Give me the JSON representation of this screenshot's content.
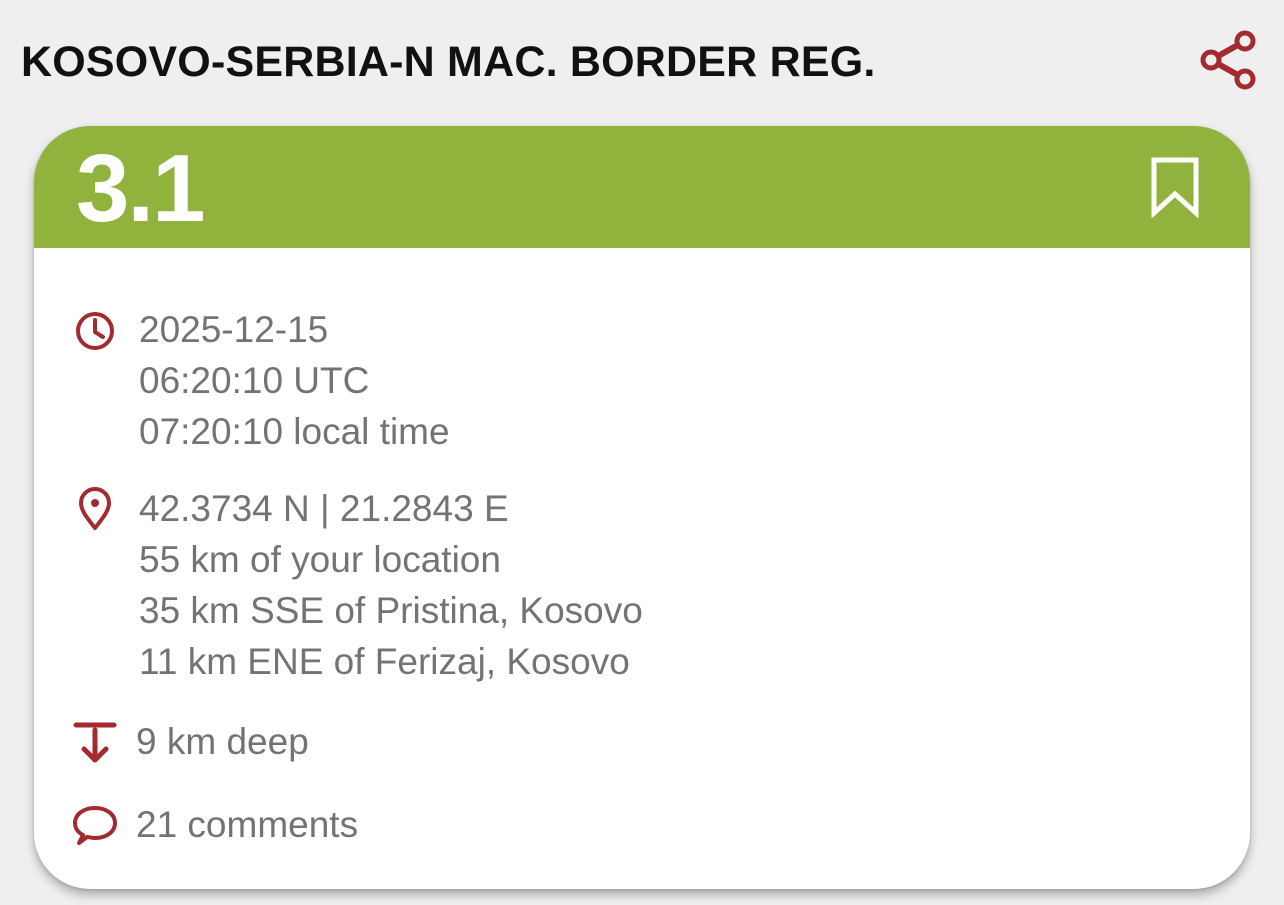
{
  "header": {
    "title": "KOSOVO-SERBIA-N MAC. BORDER REG.",
    "share_icon": "share-icon"
  },
  "quake": {
    "magnitude": "3.1",
    "magnitude_color": "#92b23e",
    "bookmark_icon": "bookmark-icon"
  },
  "time": {
    "icon": "clock-icon",
    "date": "2025-12-15",
    "utc": "06:20:10 UTC",
    "local": "07:20:10 local time"
  },
  "location": {
    "icon": "map-pin-icon",
    "coords": "42.3734 N | 21.2843 E",
    "distance_user": "55 km of your location",
    "near_1": "35 km SSE of Pristina, Kosovo",
    "near_2": "11 km ENE of Ferizaj, Kosovo"
  },
  "depth": {
    "icon": "depth-arrow-icon",
    "text": "9 km deep"
  },
  "comments": {
    "icon": "comment-icon",
    "text": "21 comments"
  },
  "colors": {
    "accent": "#a32a2f",
    "header_green": "#92b23e",
    "text_gray": "#737373",
    "background": "#efefef"
  }
}
